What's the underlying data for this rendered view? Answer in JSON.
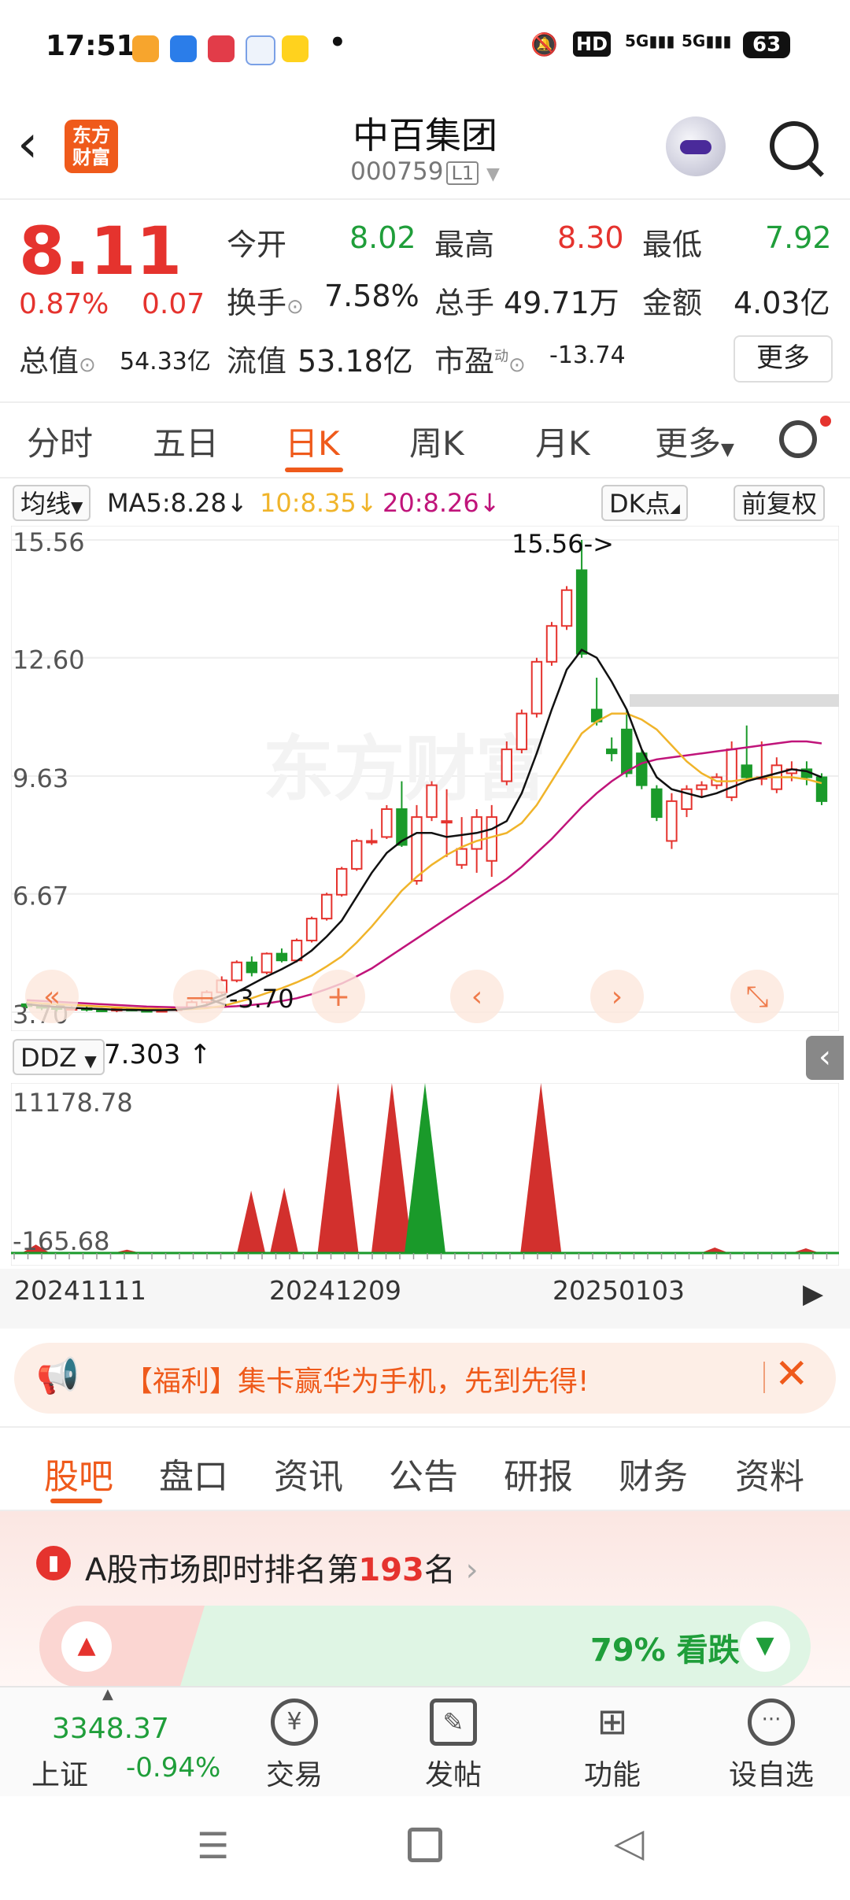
{
  "status_bar": {
    "time": "17:51",
    "battery": "63",
    "network": "5G"
  },
  "header": {
    "stock_name": "中百集团",
    "stock_code": "000759",
    "level_badge": "L1",
    "logo_text_1": "东方",
    "logo_text_2": "财富"
  },
  "quote": {
    "price": "8.11",
    "change_pct": "0.87%",
    "change": "0.07",
    "open_label": "今开",
    "open": "8.02",
    "high_label": "最高",
    "high": "8.30",
    "low_label": "最低",
    "low": "7.92",
    "turnover_label": "换手",
    "turnover": "7.58%",
    "volume_label": "总手",
    "volume": "49.71万",
    "amount_label": "金额",
    "amount": "4.03亿",
    "mktcap_label": "总值",
    "mktcap": "54.33亿",
    "float_label": "流值",
    "float_cap": "53.18亿",
    "pe_label": "市盈",
    "pe_sup": "动",
    "pe": "-13.74",
    "more_label": "更多"
  },
  "tabs": [
    "分时",
    "五日",
    "日K",
    "周K",
    "月K",
    "更多"
  ],
  "legend": {
    "ma_select": "均线",
    "ma5": "MA5:8.28",
    "ma10": "10:8.35",
    "ma20": "20:8.26",
    "dk": "DK点",
    "adjust": "前复权"
  },
  "chart_data": [
    {
      "type": "candlestick",
      "y_ticks": [
        "15.56",
        "12.60",
        "9.63",
        "6.67",
        "3.70"
      ],
      "ylim": [
        3.7,
        15.56
      ],
      "annotations": [
        "15.56->",
        "<-3.70"
      ],
      "candles": [
        {
          "o": 3.9,
          "c": 3.85,
          "h": 3.95,
          "l": 3.8
        },
        {
          "o": 3.85,
          "c": 3.82,
          "h": 3.9,
          "l": 3.75
        },
        {
          "o": 3.82,
          "c": 3.78,
          "h": 3.88,
          "l": 3.72
        },
        {
          "o": 3.78,
          "c": 3.8,
          "h": 3.85,
          "l": 3.74
        },
        {
          "o": 3.8,
          "c": 3.76,
          "h": 3.84,
          "l": 3.72
        },
        {
          "o": 3.76,
          "c": 3.74,
          "h": 3.8,
          "l": 3.7
        },
        {
          "o": 3.74,
          "c": 3.78,
          "h": 3.82,
          "l": 3.7
        },
        {
          "o": 3.78,
          "c": 3.75,
          "h": 3.82,
          "l": 3.72
        },
        {
          "o": 3.75,
          "c": 3.72,
          "h": 3.78,
          "l": 3.7
        },
        {
          "o": 3.72,
          "c": 3.75,
          "h": 3.78,
          "l": 3.7
        },
        {
          "o": 3.75,
          "c": 3.8,
          "h": 3.85,
          "l": 3.72
        },
        {
          "o": 3.8,
          "c": 3.95,
          "h": 4.0,
          "l": 3.78
        },
        {
          "o": 3.95,
          "c": 4.2,
          "h": 4.25,
          "l": 3.9
        },
        {
          "o": 4.2,
          "c": 4.5,
          "h": 4.6,
          "l": 4.15
        },
        {
          "o": 4.5,
          "c": 4.95,
          "h": 5.0,
          "l": 4.45
        },
        {
          "o": 4.95,
          "c": 4.7,
          "h": 5.1,
          "l": 4.6
        },
        {
          "o": 4.7,
          "c": 5.17,
          "h": 5.2,
          "l": 4.65
        },
        {
          "o": 5.17,
          "c": 5.0,
          "h": 5.3,
          "l": 4.95
        },
        {
          "o": 5.0,
          "c": 5.5,
          "h": 5.55,
          "l": 4.95
        },
        {
          "o": 5.5,
          "c": 6.05,
          "h": 6.1,
          "l": 5.45
        },
        {
          "o": 6.05,
          "c": 6.65,
          "h": 6.7,
          "l": 6.0
        },
        {
          "o": 6.65,
          "c": 7.3,
          "h": 7.35,
          "l": 6.6
        },
        {
          "o": 7.3,
          "c": 8.0,
          "h": 8.05,
          "l": 7.25
        },
        {
          "o": 8.0,
          "c": 8.0,
          "h": 8.3,
          "l": 7.9
        },
        {
          "o": 8.1,
          "c": 8.8,
          "h": 8.9,
          "l": 8.05
        },
        {
          "o": 8.8,
          "c": 7.9,
          "h": 9.5,
          "l": 7.85
        },
        {
          "o": 7.0,
          "c": 8.6,
          "h": 8.9,
          "l": 6.9
        },
        {
          "o": 8.6,
          "c": 9.4,
          "h": 9.5,
          "l": 8.5
        },
        {
          "o": 8.5,
          "c": 8.5,
          "h": 9.3,
          "l": 7.6
        },
        {
          "o": 7.4,
          "c": 7.8,
          "h": 8.6,
          "l": 7.3
        },
        {
          "o": 7.8,
          "c": 8.6,
          "h": 8.8,
          "l": 7.2
        },
        {
          "o": 7.5,
          "c": 8.6,
          "h": 8.9,
          "l": 7.1
        },
        {
          "o": 9.5,
          "c": 10.3,
          "h": 10.5,
          "l": 9.4
        },
        {
          "o": 10.3,
          "c": 11.2,
          "h": 11.3,
          "l": 10.2
        },
        {
          "o": 11.2,
          "c": 12.5,
          "h": 12.6,
          "l": 11.1
        },
        {
          "o": 12.5,
          "c": 13.4,
          "h": 13.5,
          "l": 12.4
        },
        {
          "o": 13.4,
          "c": 14.3,
          "h": 14.4,
          "l": 13.3
        },
        {
          "o": 14.8,
          "c": 12.7,
          "h": 15.56,
          "l": 12.6
        },
        {
          "o": 11.3,
          "c": 11.0,
          "h": 12.1,
          "l": 10.9
        },
        {
          "o": 10.3,
          "c": 10.2,
          "h": 10.6,
          "l": 10.0
        },
        {
          "o": 10.8,
          "c": 9.7,
          "h": 11.3,
          "l": 9.6
        },
        {
          "o": 10.2,
          "c": 9.4,
          "h": 10.3,
          "l": 9.3
        },
        {
          "o": 9.3,
          "c": 8.6,
          "h": 9.4,
          "l": 8.5
        },
        {
          "o": 8.0,
          "c": 9.0,
          "h": 9.2,
          "l": 7.8
        },
        {
          "o": 8.8,
          "c": 9.3,
          "h": 9.4,
          "l": 8.6
        },
        {
          "o": 9.3,
          "c": 9.4,
          "h": 9.5,
          "l": 9.1
        },
        {
          "o": 9.4,
          "c": 9.6,
          "h": 9.7,
          "l": 9.3
        },
        {
          "o": 9.1,
          "c": 10.3,
          "h": 10.5,
          "l": 9.0
        },
        {
          "o": 9.9,
          "c": 9.6,
          "h": 10.9,
          "l": 9.5
        },
        {
          "o": 9.6,
          "c": 9.6,
          "h": 10.5,
          "l": 9.4
        },
        {
          "o": 9.3,
          "c": 9.9,
          "h": 10.1,
          "l": 9.2
        },
        {
          "o": 9.7,
          "c": 9.8,
          "h": 10.0,
          "l": 9.5
        },
        {
          "o": 9.8,
          "c": 9.6,
          "h": 10.0,
          "l": 9.4
        },
        {
          "o": 9.6,
          "c": 9.0,
          "h": 9.7,
          "l": 8.9
        }
      ],
      "ma5": [
        3.9,
        3.86,
        3.83,
        3.81,
        3.79,
        3.78,
        3.76,
        3.76,
        3.75,
        3.75,
        3.76,
        3.8,
        3.88,
        4.02,
        4.2,
        4.4,
        4.6,
        4.78,
        4.98,
        5.25,
        5.6,
        6.0,
        6.6,
        7.2,
        7.7,
        8.0,
        8.2,
        8.2,
        8.1,
        8.15,
        8.2,
        8.3,
        8.5,
        9.2,
        10.2,
        11.3,
        12.3,
        12.8,
        12.6,
        12.0,
        11.3,
        10.3,
        9.6,
        9.3,
        9.2,
        9.1,
        9.2,
        9.35,
        9.5,
        9.6,
        9.7,
        9.8,
        9.75,
        9.6
      ],
      "ma10": [
        3.95,
        3.92,
        3.9,
        3.88,
        3.86,
        3.84,
        3.82,
        3.8,
        3.79,
        3.78,
        3.77,
        3.78,
        3.8,
        3.85,
        3.95,
        4.05,
        4.18,
        4.3,
        4.45,
        4.62,
        4.85,
        5.1,
        5.45,
        5.85,
        6.3,
        6.75,
        7.1,
        7.4,
        7.65,
        7.85,
        8.0,
        8.1,
        8.2,
        8.45,
        8.9,
        9.5,
        10.1,
        10.7,
        11.0,
        11.2,
        11.2,
        11.05,
        10.8,
        10.4,
        10.0,
        9.7,
        9.5,
        9.5,
        9.55,
        9.6,
        9.6,
        9.6,
        9.55,
        9.45
      ],
      "ma20": [
        4.0,
        3.98,
        3.96,
        3.94,
        3.92,
        3.9,
        3.88,
        3.86,
        3.84,
        3.83,
        3.82,
        3.82,
        3.82,
        3.83,
        3.85,
        3.88,
        3.92,
        3.98,
        4.05,
        4.15,
        4.28,
        4.42,
        4.6,
        4.8,
        5.05,
        5.3,
        5.55,
        5.8,
        6.05,
        6.3,
        6.55,
        6.8,
        7.05,
        7.35,
        7.7,
        8.05,
        8.45,
        8.85,
        9.2,
        9.5,
        9.75,
        9.95,
        10.05,
        10.1,
        10.15,
        10.2,
        10.25,
        10.3,
        10.35,
        10.4,
        10.45,
        10.5,
        10.5,
        10.45
      ],
      "series_colors": {
        "ma5": "#111111",
        "ma10": "#f0b42a",
        "ma20": "#c0147a",
        "up": "#e5332e",
        "down": "#1a9a2a"
      }
    },
    {
      "type": "area",
      "name": "DDZ",
      "value_label": "7.303",
      "y_ticks": [
        "11178.78",
        "-165.68"
      ],
      "ylim": [
        -165.68,
        11178.78
      ],
      "peaks": [
        {
          "pos": 0.03,
          "v": 400,
          "col": "red"
        },
        {
          "pos": 0.14,
          "v": 60,
          "col": "red"
        },
        {
          "pos": 0.29,
          "v": 4000,
          "col": "red"
        },
        {
          "pos": 0.33,
          "v": 4200,
          "col": "red"
        },
        {
          "pos": 0.395,
          "v": 12000,
          "col": "red"
        },
        {
          "pos": 0.46,
          "v": 12000,
          "col": "red"
        },
        {
          "pos": 0.5,
          "v": 12000,
          "col": "green"
        },
        {
          "pos": 0.64,
          "v": 12000,
          "col": "red"
        },
        {
          "pos": 0.85,
          "v": 200,
          "col": "red"
        },
        {
          "pos": 0.96,
          "v": 150,
          "col": "red"
        }
      ]
    }
  ],
  "indicator": {
    "name": "DDZ",
    "value": "7.303"
  },
  "dates": [
    "20241111",
    "20241209",
    "20250103"
  ],
  "promo": {
    "text": "【福利】集卡赢华为手机，先到先得!"
  },
  "bottom_tabs": [
    "股吧",
    "盘口",
    "资讯",
    "公告",
    "研报",
    "财务",
    "资料"
  ],
  "rank": {
    "prefix": "A股市场即时排名第",
    "number": "193",
    "suffix": "名",
    "vote_text": "79% 看跌"
  },
  "bottom_nav": {
    "index_value": "3348.37",
    "index_name": "上证",
    "index_change": "-0.94%",
    "items": [
      "交易",
      "发帖",
      "功能",
      "设自选"
    ]
  }
}
